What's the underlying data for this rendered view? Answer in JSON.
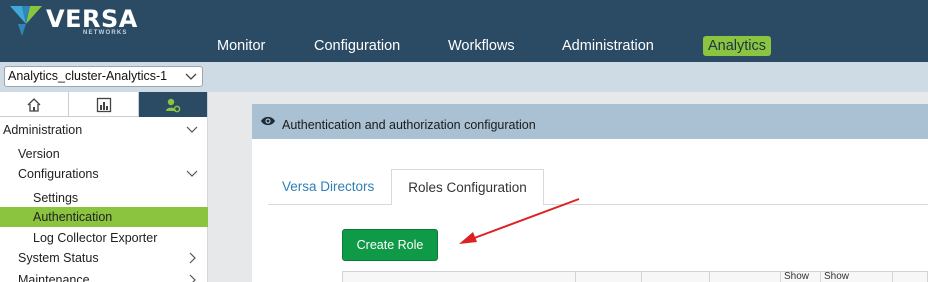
{
  "brand": {
    "name": "VERSA",
    "sub": "NETWORKS"
  },
  "nav": {
    "items": [
      {
        "label": "Monitor"
      },
      {
        "label": "Configuration"
      },
      {
        "label": "Workflows"
      },
      {
        "label": "Administration"
      },
      {
        "label": "Analytics",
        "active": true
      }
    ]
  },
  "cluster": {
    "selected": "Analytics_cluster-Analytics-1"
  },
  "sidebar": {
    "tabs": [
      {
        "icon": "home-icon"
      },
      {
        "icon": "bar-chart-icon"
      },
      {
        "icon": "admin-user-icon",
        "active": true
      }
    ],
    "items": [
      {
        "label": "Administration"
      },
      {
        "label": "Version"
      },
      {
        "label": "Configurations"
      },
      {
        "label": "Settings"
      },
      {
        "label": "Authentication",
        "active": true
      },
      {
        "label": "Log Collector Exporter"
      },
      {
        "label": "System Status"
      },
      {
        "label": "Maintenance"
      }
    ]
  },
  "panel": {
    "title": "Authentication and authorization configuration"
  },
  "tabs": [
    {
      "label": "Versa Directors"
    },
    {
      "label": "Roles Configuration",
      "active": true
    }
  ],
  "actions": {
    "create_role": "Create Role"
  },
  "table": {
    "headers": [
      "Show",
      "Show"
    ]
  },
  "colors": {
    "header": "#2b4a63",
    "accent": "#8bc53f",
    "button": "#0e9a47",
    "panel_header": "#a9c1d3"
  }
}
